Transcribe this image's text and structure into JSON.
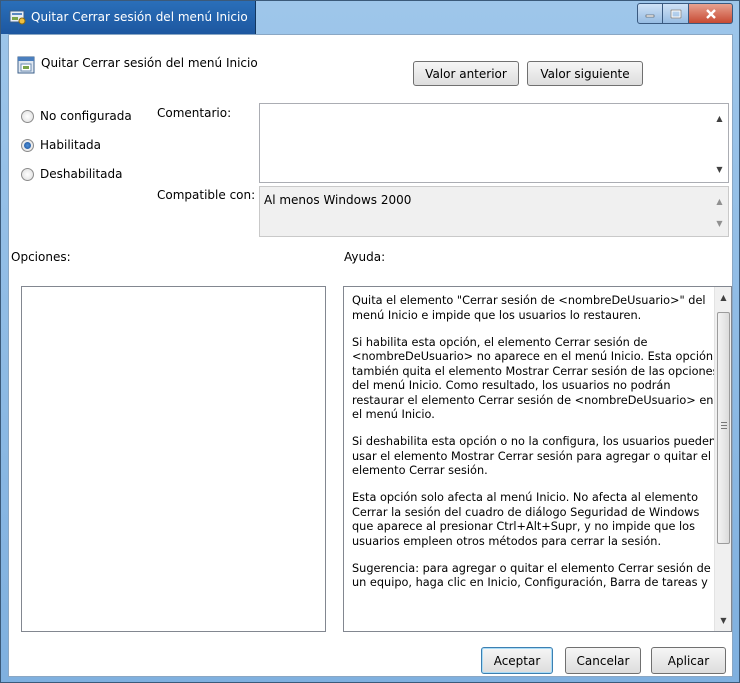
{
  "window": {
    "title": "Quitar Cerrar sesión del menú Inicio",
    "caption_buttons": [
      "minimize-icon",
      "maximize-icon",
      "close-icon"
    ]
  },
  "header": {
    "setting_name": "Quitar Cerrar sesión del menú Inicio",
    "prev_button": "Valor anterior",
    "next_button": "Valor siguiente"
  },
  "state": {
    "options": [
      {
        "label": "No configurada",
        "selected": false
      },
      {
        "label": "Habilitada",
        "selected": true
      },
      {
        "label": "Deshabilitada",
        "selected": false
      }
    ]
  },
  "comment": {
    "label": "Comentario:",
    "value": ""
  },
  "compatible": {
    "label": "Compatible con:",
    "value": "Al menos Windows 2000"
  },
  "options_panel": {
    "label": "Opciones:"
  },
  "help_panel": {
    "label": "Ayuda:",
    "paragraphs": [
      "Quita el elemento \"Cerrar sesión de <nombreDeUsuario>\" del menú Inicio e impide que los usuarios lo restauren.",
      "Si habilita esta opción, el elemento Cerrar sesión de <nombreDeUsuario> no aparece en el menú Inicio. Esta opción también quita el elemento Mostrar Cerrar sesión de las opciones del menú Inicio. Como resultado, los usuarios no podrán restaurar el elemento Cerrar sesión de <nombreDeUsuario> en el menú Inicio.",
      "Si deshabilita esta opción o no la configura, los usuarios pueden usar el elemento Mostrar Cerrar sesión para agregar o quitar el elemento Cerrar sesión.",
      "Esta opción solo afecta al menú Inicio. No afecta al elemento Cerrar la sesión del cuadro de diálogo Seguridad de Windows que aparece al presionar Ctrl+Alt+Supr, y no impide que los usuarios empleen otros métodos para cerrar la sesión.",
      "Sugerencia: para agregar o quitar el elemento Cerrar sesión de un equipo, haga clic en Inicio, Configuración, Barra de tareas y"
    ]
  },
  "footer": {
    "ok": "Aceptar",
    "cancel": "Cancelar",
    "apply": "Aplicar"
  }
}
